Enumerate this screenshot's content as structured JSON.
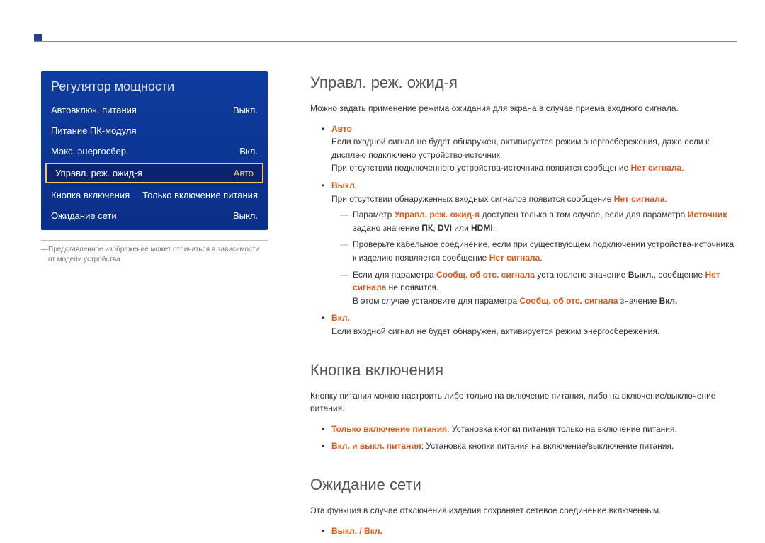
{
  "menu": {
    "title": "Регулятор мощности",
    "rows": [
      {
        "label": "Автовключ. питания",
        "value": "Выкл."
      },
      {
        "label": "Питание ПК-модуля",
        "value": ""
      },
      {
        "label": "Макс. энергосбер.",
        "value": "Вкл."
      },
      {
        "label": "Управл. реж. ожид-я",
        "value": "Авто"
      },
      {
        "label": "Кнопка включения",
        "value": "Только включение питания"
      },
      {
        "label": "Ожидание сети",
        "value": "Выкл."
      }
    ],
    "caption": "Представленное изображение может отличаться в зависимости от модели устройства."
  },
  "s1": {
    "title": "Управл. реж. ожид-я",
    "intro": "Можно задать применение режима ожидания для экрана в случае приема входного сигнала.",
    "auto_label": "Авто",
    "auto_p1": "Если входной сигнал не будет обнаружен, активируется режим энергосбережения, даже если к дисплею подключено устройство-источник.",
    "auto_p2_a": "При отсутствии подключенного устройства-источника появится сообщение ",
    "auto_p2_b": "Нет сигнала",
    "auto_p2_c": ".",
    "off_label": "Выкл.",
    "off_p1_a": "При отсутствии обнаруженных входных сигналов появится сообщение ",
    "off_p1_b": "Нет сигнала",
    "off_p1_c": ".",
    "off_n1_a": "Параметр ",
    "off_n1_b": "Управл. реж. ожид-я",
    "off_n1_c": " доступен только в том случае, если для параметра ",
    "off_n1_d": "Источник",
    "off_n1_e": " задано значение ",
    "off_n1_f": "ПК",
    "off_n1_g": ", ",
    "off_n1_h": "DVI",
    "off_n1_i": " или ",
    "off_n1_j": "HDMI",
    "off_n1_k": ".",
    "off_n2_a": "Проверьте кабельное соединение, если при существующем подключении устройства-источника к изделию появляется сообщение ",
    "off_n2_b": "Нет сигнала",
    "off_n2_c": ".",
    "off_n3_a": "Если для параметра ",
    "off_n3_b": "Сообщ. об отс. сигнала",
    "off_n3_c": " установлено значение ",
    "off_n3_d": "Выкл.",
    "off_n3_e": ", сообщение ",
    "off_n3_f": "Нет сигнала",
    "off_n3_g": " не появится.",
    "off_n3_h": "В этом случае установите для параметра ",
    "off_n3_i": "Сообщ. об отс. сигнала",
    "off_n3_j": " значение ",
    "off_n3_k": "Вкл.",
    "on_label": "Вкл.",
    "on_p1": "Если входной сигнал не будет обнаружен, активируется режим энергосбережения."
  },
  "s2": {
    "title": "Кнопка включения",
    "intro": "Кнопку питания можно настроить либо только на включение питания, либо на включение/выключение питания.",
    "b1_a": "Только включение питания",
    "b1_b": ": Установка кнопки питания только на включение питания.",
    "b2_a": "Вкл. и выкл. питания",
    "b2_b": ": Установка кнопки питания на включение/выключение питания."
  },
  "s3": {
    "title": "Ожидание сети",
    "intro": "Эта функция в случае отключения изделия сохраняет сетевое соединение включенным.",
    "b1": "Выкл. / Вкл."
  }
}
